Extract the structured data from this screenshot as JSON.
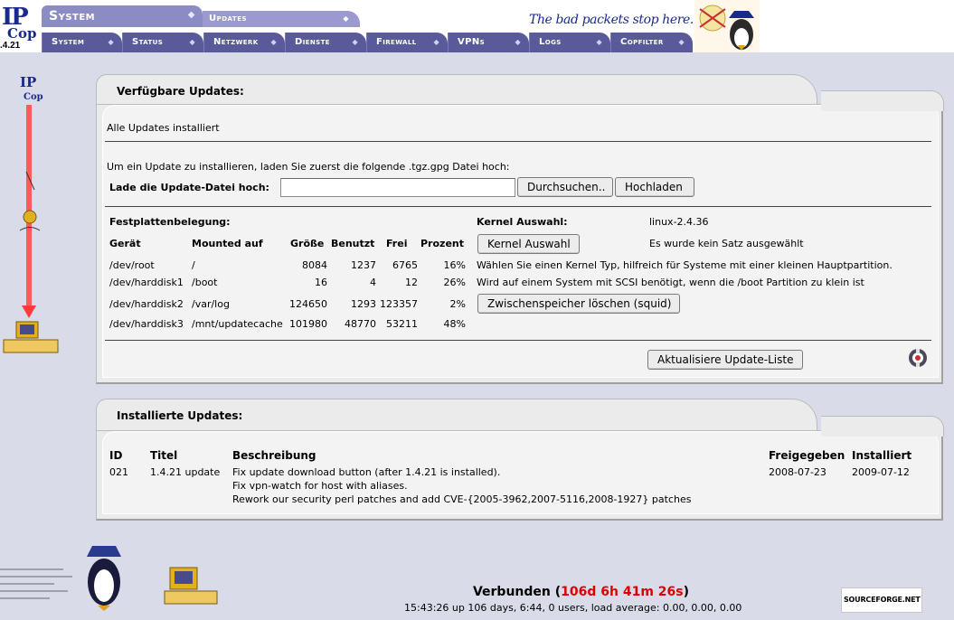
{
  "app": {
    "logo_text": "IP",
    "logo_sub": "Cop",
    "version": ".4.21",
    "section_title": "System",
    "page_tab": "Updates",
    "slogan": "The bad packets stop here."
  },
  "nav": [
    {
      "label": "System"
    },
    {
      "label": "Status"
    },
    {
      "label": "Netzwerk"
    },
    {
      "label": "Dienste"
    },
    {
      "label": "Firewall"
    },
    {
      "label": "VPNs"
    },
    {
      "label": "Logs"
    },
    {
      "label": "Copfilter"
    }
  ],
  "available": {
    "title": "Verfügbare Updates:",
    "status": "Alle Updates installiert",
    "instruction": "Um ein Update zu installieren, laden Sie zuerst die folgende .tgz.gpg Datei hoch:",
    "upload_label": "Lade die Update-Datei hoch:",
    "file_value": "",
    "browse_button": "Durchsuchen..",
    "upload_button": "Hochladen",
    "disk_title": "Festplattenbelegung:",
    "disk_headers": {
      "device": "Gerät",
      "mount": "Mounted auf",
      "size": "Größe",
      "used": "Benutzt",
      "free": "Frei",
      "percent": "Prozent"
    },
    "disks": [
      {
        "device": "/dev/root",
        "mount": "/",
        "size": "8084",
        "used": "1237",
        "free": "6765",
        "percent": "16%"
      },
      {
        "device": "/dev/harddisk1",
        "mount": "/boot",
        "size": "16",
        "used": "4",
        "free": "12",
        "percent": "26%"
      },
      {
        "device": "/dev/harddisk2",
        "mount": "/var/log",
        "size": "124650",
        "used": "1293",
        "free": "123357",
        "percent": "2%"
      },
      {
        "device": "/dev/harddisk3",
        "mount": "/mnt/updatecache",
        "size": "101980",
        "used": "48770",
        "free": "53211",
        "percent": "48%"
      }
    ],
    "kernel_label": "Kernel Auswahl:",
    "kernel_value": "linux-2.4.36",
    "kernel_button": "Kernel Auswahl",
    "kernel_status": "Es wurde kein Satz ausgewählt",
    "kernel_hint1": "Wählen Sie einen Kernel Typ, hilfreich für Systeme mit einer kleinen Hauptpartition.",
    "kernel_hint2": "Wird auf einem System mit SCSI benötigt, wenn die /boot Partition zu klein ist",
    "cache_button": "Zwischenspeicher löschen (squid)",
    "refresh_button": "Aktualisiere Update-Liste"
  },
  "installed": {
    "title": "Installierte Updates:",
    "headers": {
      "id": "ID",
      "title": "Titel",
      "desc": "Beschreibung",
      "released": "Freigegeben",
      "installed": "Installiert"
    },
    "rows": [
      {
        "id": "021",
        "title": "1.4.21 update",
        "desc1": "Fix update download button (after 1.4.21 is installed).",
        "desc2": "Fix vpn-watch for host with aliases.",
        "desc3": "Rework our security perl patches and add CVE-{2005-3962,2007-5116,2008-1927} patches",
        "released": "2008-07-23",
        "installed": "2009-07-12"
      }
    ]
  },
  "footer": {
    "connected_label": "Verbunden",
    "connected_time": "106d 6h 41m 26s",
    "uptime": "15:43:26 up 106 days, 6:44, 0 users, load average: 0.00, 0.00, 0.00",
    "sourceforge": "SOURCEFORGE.NET"
  },
  "colors": {
    "nav_bg": "#5a5a9a",
    "title_bg": "#8c8cc4",
    "page_bg": "#d9dbe9",
    "brand_text": "#1a2a8c",
    "connected_time": "#dd0000"
  }
}
